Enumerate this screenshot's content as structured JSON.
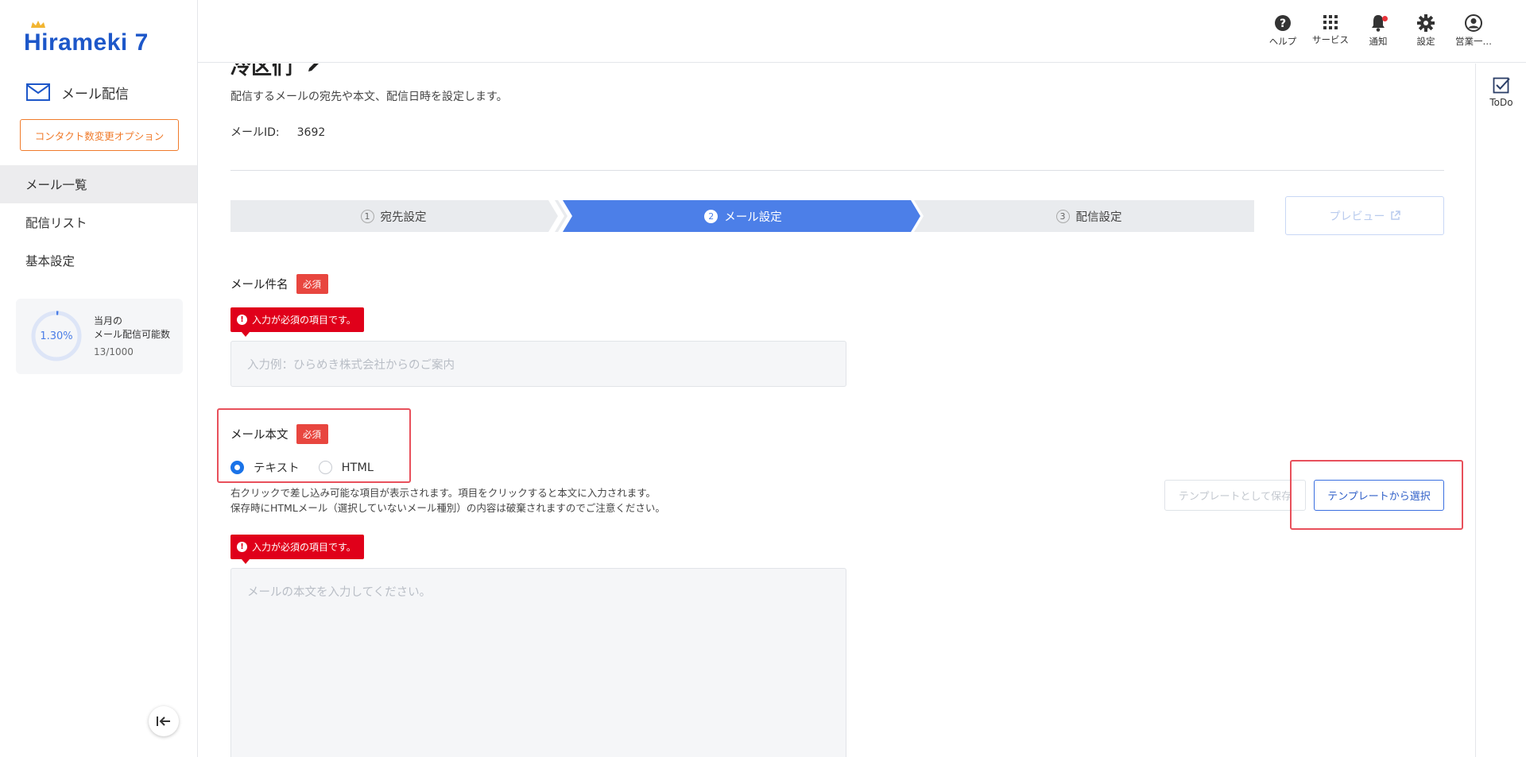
{
  "app": {
    "logo_text": "Hirameki 7"
  },
  "sidebar": {
    "section_title": "メール配信",
    "contact_button": "コンタクト数変更オプション",
    "items": [
      {
        "label": "メール一覧",
        "active": true
      },
      {
        "label": "配信リスト",
        "active": false
      },
      {
        "label": "基本設定",
        "active": false
      }
    ],
    "quota": {
      "percent_text": "1.30%",
      "percent": 1.3,
      "label_line1": "当月の",
      "label_line2": "メール配信可能数",
      "count": "13/1000"
    }
  },
  "header": {
    "items": [
      {
        "label": "ヘルプ",
        "icon": "help-icon"
      },
      {
        "label": "サービス",
        "icon": "grid-icon"
      },
      {
        "label": "通知",
        "icon": "bell-icon"
      },
      {
        "label": "設定",
        "icon": "gear-icon"
      },
      {
        "label": "営業一…",
        "icon": "user-icon"
      }
    ]
  },
  "todo": {
    "label": "ToDo"
  },
  "main": {
    "page_title": "冷区们",
    "description": "配信するメールの宛先や本文、配信日時を設定します。",
    "mail_id_label": "メールID:",
    "mail_id_value": "3692",
    "steps": [
      {
        "num": "1",
        "label": "宛先設定",
        "active": false
      },
      {
        "num": "2",
        "label": "メール設定",
        "active": true
      },
      {
        "num": "3",
        "label": "配信設定",
        "active": false
      }
    ],
    "preview_button": "プレビュー",
    "subject": {
      "label": "メール件名",
      "required": "必須",
      "error": "入力が必須の項目です。",
      "placeholder": "入力例：ひらめき株式会社からのご案内"
    },
    "body": {
      "label": "メール本文",
      "required": "必須",
      "radio_text": "テキスト",
      "radio_html": "HTML",
      "note_line1": "右クリックで差し込み可能な項目が表示されます。項目をクリックすると本文に入力されます。",
      "note_line2": "保存時にHTMLメール（選択していないメール種別）の内容は破棄されますのでご注意ください。",
      "save_template": "テンプレートとして保存",
      "select_template": "テンプレートから選択",
      "error": "入力が必須の項目です。",
      "placeholder": "メールの本文を入力してください。"
    }
  },
  "colors": {
    "accent": "#4a7de6",
    "error": "#e0001a",
    "required": "#e8463f",
    "contact": "#f07b2b",
    "highlight": "#e8505b"
  }
}
